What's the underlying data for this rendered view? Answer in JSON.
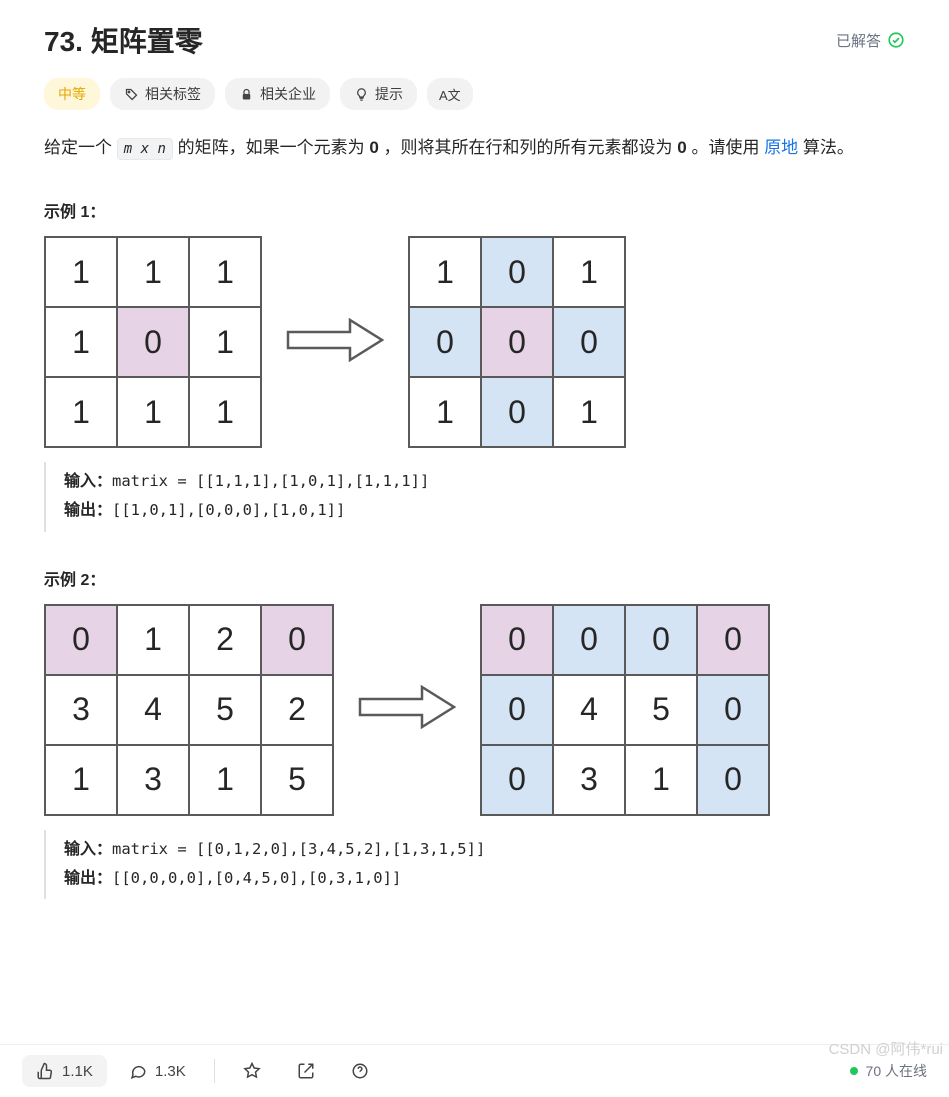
{
  "title": "73. 矩阵置零",
  "solved_label": "已解答",
  "tags": {
    "difficulty": "中等",
    "related_tags": "相关标签",
    "companies": "相关企业",
    "hint": "提示",
    "translate": "A文"
  },
  "description": {
    "prefix": "给定一个 ",
    "code": "m x n",
    "mid1": " 的矩阵，如果一个元素为 ",
    "bold1": "0",
    "mid2": " ，则将其所在行和列的所有元素都设为 ",
    "bold2": "0",
    "mid3": " 。请使用 ",
    "link": "原地",
    "suffix": " 算法。"
  },
  "example1": {
    "heading": "示例 1：",
    "matrix_in": [
      [
        "1",
        "1",
        "1"
      ],
      [
        "1",
        "0",
        "1"
      ],
      [
        "1",
        "1",
        "1"
      ]
    ],
    "matrix_in_styles": [
      [
        "",
        "",
        ""
      ],
      [
        "",
        "pink",
        ""
      ],
      [
        "",
        "",
        ""
      ]
    ],
    "matrix_out": [
      [
        "1",
        "0",
        "1"
      ],
      [
        "0",
        "0",
        "0"
      ],
      [
        "1",
        "0",
        "1"
      ]
    ],
    "matrix_out_styles": [
      [
        "",
        "blue",
        ""
      ],
      [
        "blue",
        "pink",
        "blue"
      ],
      [
        "",
        "blue",
        ""
      ]
    ],
    "input_label": "输入：",
    "input_code": "matrix = [[1,1,1],[1,0,1],[1,1,1]]",
    "output_label": "输出：",
    "output_code": "[[1,0,1],[0,0,0],[1,0,1]]"
  },
  "example2": {
    "heading": "示例 2：",
    "matrix_in": [
      [
        "0",
        "1",
        "2",
        "0"
      ],
      [
        "3",
        "4",
        "5",
        "2"
      ],
      [
        "1",
        "3",
        "1",
        "5"
      ]
    ],
    "matrix_in_styles": [
      [
        "pink",
        "",
        "",
        "pink"
      ],
      [
        "",
        "",
        "",
        ""
      ],
      [
        "",
        "",
        "",
        ""
      ]
    ],
    "matrix_out": [
      [
        "0",
        "0",
        "0",
        "0"
      ],
      [
        "0",
        "4",
        "5",
        "0"
      ],
      [
        "0",
        "3",
        "1",
        "0"
      ]
    ],
    "matrix_out_styles": [
      [
        "pink",
        "blue",
        "blue",
        "pink"
      ],
      [
        "blue",
        "",
        "",
        "blue"
      ],
      [
        "blue",
        "",
        "",
        "blue"
      ]
    ],
    "input_label": "输入：",
    "input_code": "matrix = [[0,1,2,0],[3,4,5,2],[1,3,1,5]]",
    "output_label": "输出：",
    "output_code": "[[0,0,0,0],[0,4,5,0],[0,3,1,0]]"
  },
  "footer": {
    "likes": "1.1K",
    "comments": "1.3K",
    "online_count": "70",
    "online_suffix": "人在线"
  },
  "watermark": "CSDN @阿伟*rui"
}
